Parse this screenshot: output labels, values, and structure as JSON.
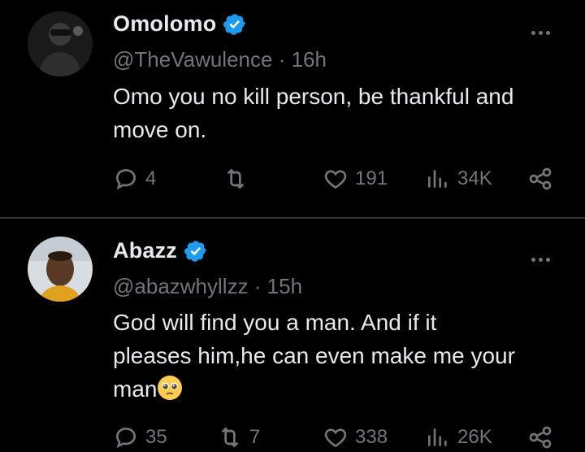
{
  "tweets": [
    {
      "name": "Omolomo",
      "handle": "@TheVawulence",
      "time": "16h",
      "text_lines": [
        "Omo you no kill person, be thankful and",
        "move on."
      ],
      "replies": "4",
      "reposts": "",
      "likes": "191",
      "views": "34K"
    },
    {
      "name": "Abazz",
      "handle": "@abazwhyllzz",
      "time": "15h",
      "text_lines": [
        "God will find you a man. And if it",
        "pleases him,he can even make me your",
        "man"
      ],
      "emoji": "pleading-face-emoji",
      "replies": "35",
      "reposts": "7",
      "likes": "338",
      "views": "26K"
    }
  ],
  "separator": " · ",
  "colors": {
    "background": "#000000",
    "text": "#e7e9ea",
    "secondary": "#71767b",
    "verified": "#1d9bf0",
    "divider": "#2f3336"
  }
}
